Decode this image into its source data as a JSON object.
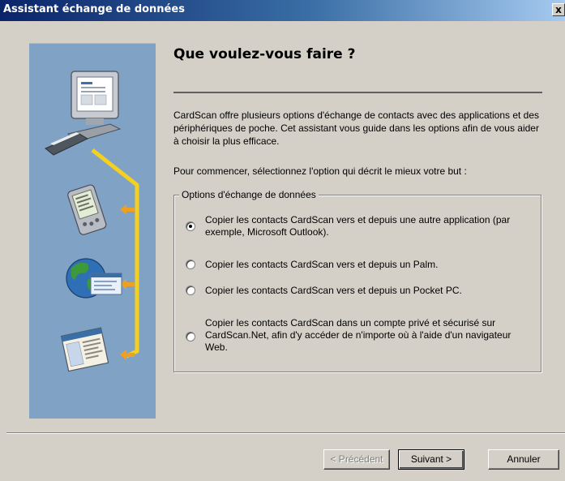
{
  "window": {
    "title": "Assistant échange de données",
    "close_label": "x"
  },
  "main": {
    "heading": "Que voulez-vous faire ?",
    "intro": "CardScan offre plusieurs options d'échange de contacts avec des applications et des périphériques de poche. Cet assistant vous guide dans les options afin de vous aider à choisir la plus efficace.",
    "prompt": "Pour commencer, sélectionnez l'option qui décrit le mieux votre but :",
    "group_label": "Options d'échange de données",
    "options": [
      {
        "label": "Copier les contacts CardScan vers et depuis une autre application (par exemple, Microsoft Outlook).",
        "selected": true
      },
      {
        "label": "Copier les contacts CardScan vers et depuis un Palm.",
        "selected": false
      },
      {
        "label": "Copier les contacts CardScan vers et depuis un Pocket PC.",
        "selected": false
      },
      {
        "label": "Copier les contacts CardScan dans un compte privé et sécurisé sur CardScan.Net, afin d'y accéder de n'importe où à l'aide d'un navigateur Web.",
        "selected": false
      }
    ]
  },
  "side_panel": {
    "icons": [
      "computer-scanner-icon",
      "palm-handheld-icon",
      "globe-web-icon",
      "web-browser-window-icon"
    ],
    "background_color": "#7fa2c5",
    "connector_color": "#f4d020",
    "arrow_color": "#f0a020"
  },
  "buttons": {
    "back_label": "< Précédent",
    "next_label": "Suivant >",
    "cancel_label": "Annuler"
  }
}
